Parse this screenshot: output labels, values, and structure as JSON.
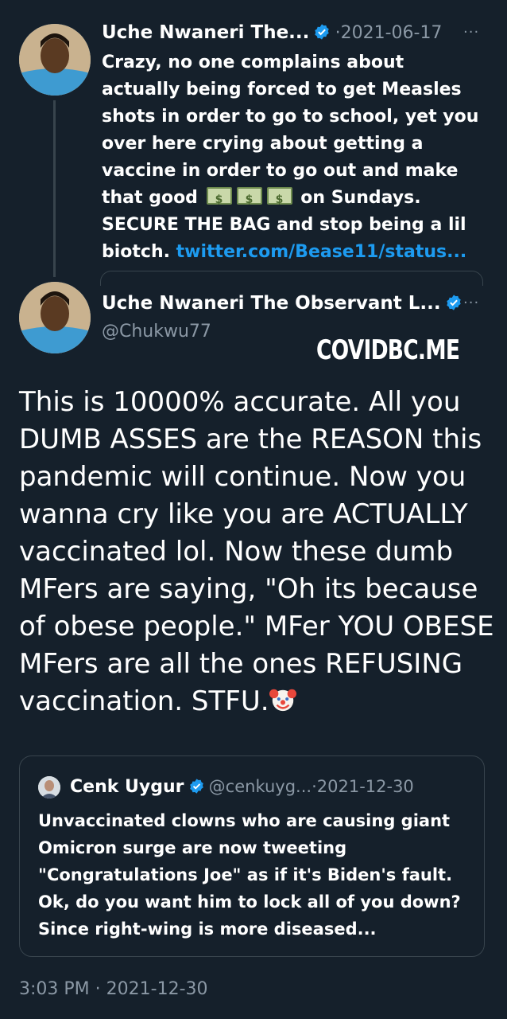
{
  "reply_tweet": {
    "author_name": "Uche Nwaneri The...",
    "separator": "·",
    "date": "2021-06-17",
    "more": "···",
    "text_part1": "Crazy, no one complains about actually being forced to get Measles shots in order to go to school, yet you over here crying about getting a vaccine in order to go out and make that good",
    "money_emoji": "money-with-wings",
    "text_part2": "on Sundays. SECURE THE BAG and stop being a lil biotch.",
    "link": "twitter.com/Bease11/status..."
  },
  "main_tweet": {
    "author_name": "Uche Nwaneri The Observant L...",
    "handle": "@Chukwu77",
    "more": "···",
    "text": "This is 10000% accurate. All you DUMB ASSES are the REASON this pandemic will continue. Now you wanna cry like you are ACTUALLY vaccinated lol. Now these dumb MFers are saying, \"Oh its because of obese people.\" MFer YOU OBESE MFers are all the ones REFUSING vaccination. STFU.",
    "emoji": "clown-face"
  },
  "watermark": "COVIDBC.ME",
  "quoted_tweet": {
    "author_name": "Cenk Uygur",
    "handle": "@cenkuyg...",
    "separator": "·",
    "date": "2021-12-30",
    "text": "Unvaccinated clowns who are causing giant Omicron surge are now tweeting \"Congratulations Joe\" as if it's Biden's fault. Ok, do you want him to lock all of you down? Since right-wing is more diseased..."
  },
  "footer": {
    "time": "3:03 PM",
    "separator": "·",
    "date": "2021-12-30"
  },
  "colors": {
    "background": "#15202b",
    "link": "#1d9bf0",
    "muted": "#8b98a5",
    "verified": "#1d9bf0"
  }
}
